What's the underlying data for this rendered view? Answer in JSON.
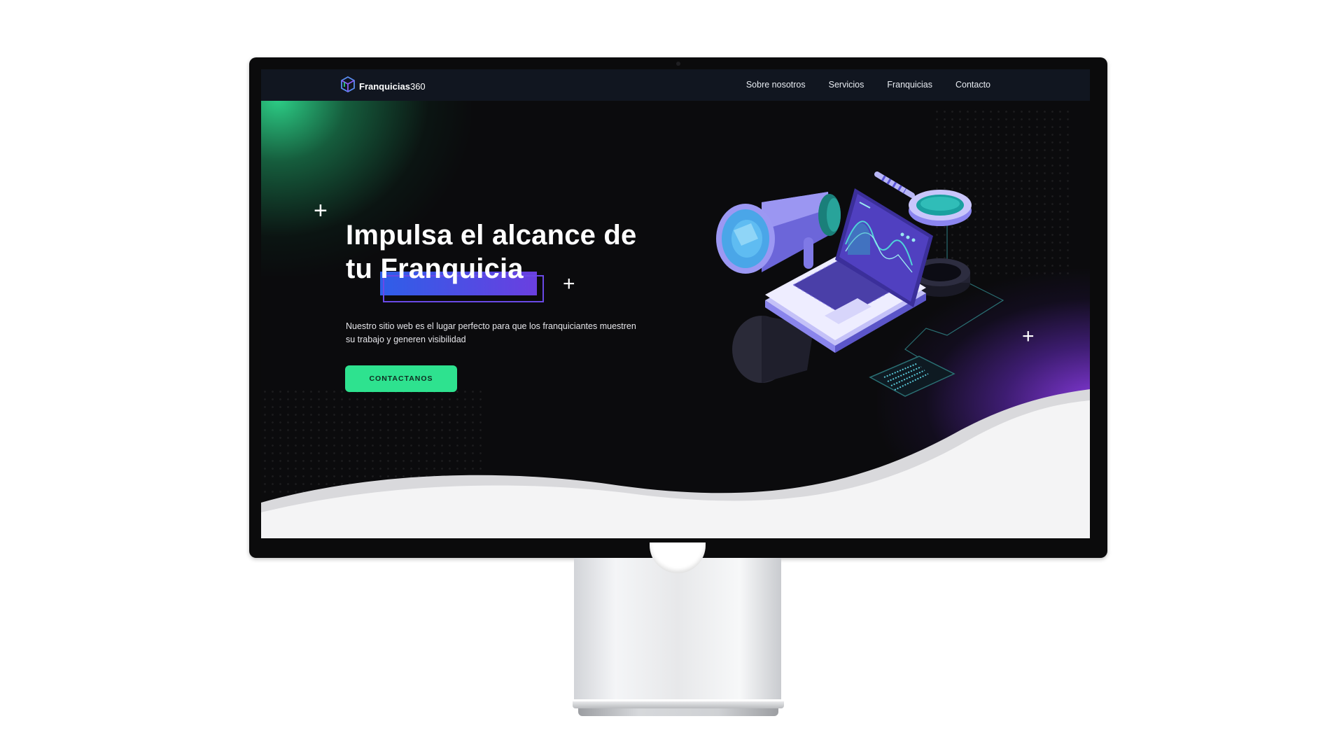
{
  "brand": {
    "name_bold": "Franquicias",
    "name_suffix": "360",
    "logo_icon": "cube-icon"
  },
  "nav": {
    "items": [
      {
        "label": "Sobre nosotros"
      },
      {
        "label": "Servicios"
      },
      {
        "label": "Franquicias"
      },
      {
        "label": "Contacto"
      }
    ]
  },
  "hero": {
    "title_line1": "Impulsa el alcance de",
    "title_prefix": "tu ",
    "title_highlight": "Franquicia",
    "subtitle": "Nuestro sitio web es el lugar perfecto para que los franquiciantes muestren su trabajo y generen visibilidad",
    "cta_label": "CONTACTANOS",
    "illustration": "megaphone-laptop-magnifier-illustration"
  },
  "colors": {
    "accent_green": "#2ee28f",
    "accent_purple": "#6a3fe0",
    "nav_bg": "#111620",
    "hero_bg": "#0b0b0d"
  }
}
